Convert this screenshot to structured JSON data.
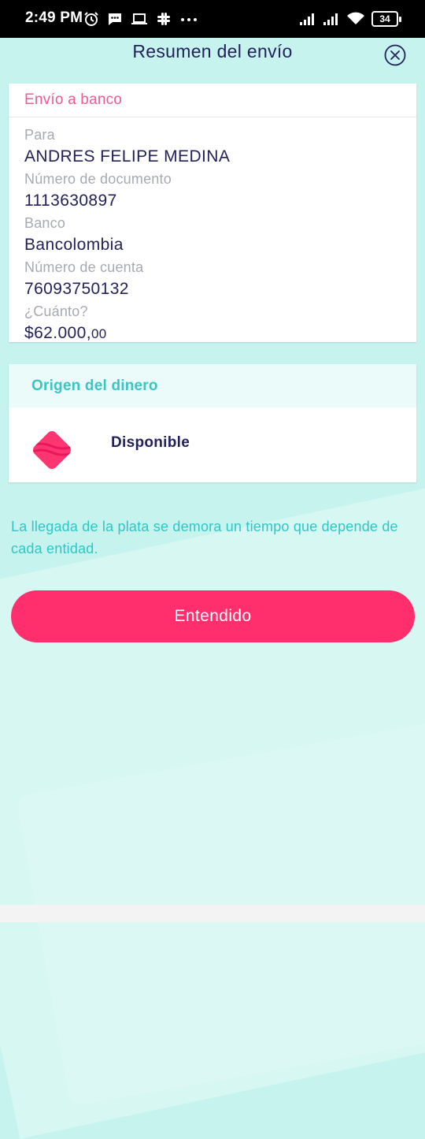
{
  "status_bar": {
    "time": "2:49 PM",
    "battery": "34",
    "left_icons": [
      "alarm-icon",
      "message-icon",
      "laptop-icon",
      "slack-icon",
      "more-dots-icon"
    ],
    "right_icons": [
      "signal-icon",
      "signal-icon",
      "wifi-icon",
      "battery-icon"
    ]
  },
  "header": {
    "title": "Resumen del envío",
    "close_icon": "close-circle-icon"
  },
  "transfer": {
    "section_title": "Envío a banco",
    "fields": [
      {
        "label": "Para",
        "value": "ANDRES FELIPE MEDINA"
      },
      {
        "label": "Número de documento",
        "value": "1113630897"
      },
      {
        "label": "Banco",
        "value": "Bancolombia"
      },
      {
        "label": "Número de cuenta",
        "value": "76093750132"
      }
    ],
    "amount_label": "¿Cuánto?",
    "amount_main": "$62.000,",
    "amount_cents": "00"
  },
  "origin": {
    "section_title": "Origen del dinero",
    "source_label": "Disponible",
    "source_icon": "wallet-diamond-icon"
  },
  "info_text": "La llegada de la plata se demora un tiempo que depende de cada entidad.",
  "cta": {
    "label": "Entendido"
  },
  "colors": {
    "background": "#c6f3ee",
    "accent_pink": "#ff2f6e",
    "section_pink": "#ef5b93",
    "teal": "#3ac5c2",
    "navy_text": "#23215a",
    "muted_label": "#a7a9b3"
  }
}
